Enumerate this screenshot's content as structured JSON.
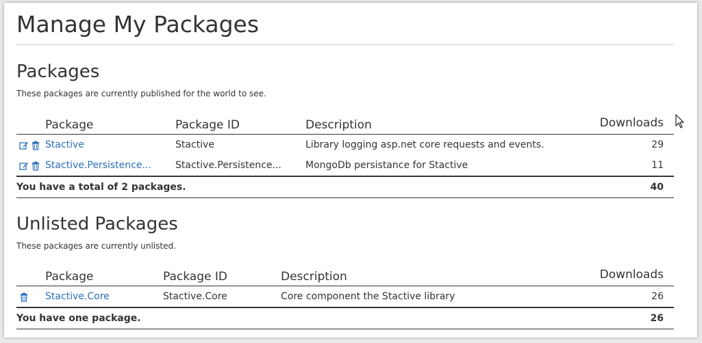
{
  "page": {
    "title": "Manage My Packages"
  },
  "listed": {
    "title": "Packages",
    "subtitle": "These packages are currently published for the world to see.",
    "columns": {
      "package": "Package",
      "id": "Package ID",
      "description": "Description",
      "downloads": "Downloads"
    },
    "rows": [
      {
        "package": "Stactive",
        "id": "Stactive",
        "description": "Library logging asp.net core requests and events.",
        "downloads": "29"
      },
      {
        "package": "Stactive.Persistence...",
        "id": "Stactive.Persistence...",
        "description": "MongoDb persistance for Stactive",
        "downloads": "11"
      }
    ],
    "footer": {
      "text": "You have a total of 2 packages.",
      "total": "40"
    }
  },
  "unlisted": {
    "title": "Unlisted Packages",
    "subtitle": "These packages are currently unlisted.",
    "columns": {
      "package": "Package",
      "id": "Package ID",
      "description": "Description",
      "downloads": "Downloads"
    },
    "rows": [
      {
        "package": "Stactive.Core",
        "id": "Stactive.Core",
        "description": "Core component the Stactive library",
        "downloads": "26"
      }
    ],
    "footer": {
      "text": "You have one package.",
      "total": "26"
    }
  },
  "colors": {
    "link": "#2a6ebb",
    "icon": "#2a6ebb",
    "text": "#333333"
  },
  "icons": {
    "edit": "edit-icon",
    "delete": "trash-icon"
  }
}
